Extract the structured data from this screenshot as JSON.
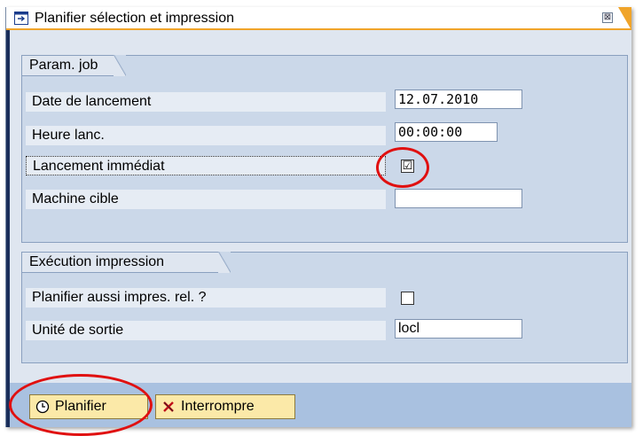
{
  "dialog": {
    "title": "Planifier sélection et impression",
    "close_symbol": "⊠"
  },
  "job_params": {
    "heading": "Param. job",
    "start_date_label": "Date de lancement",
    "start_date_value": "12.07.2010",
    "start_time_label": "Heure lanc.",
    "start_time_value": "00:00:00",
    "immediate_label": "Lancement immédiat",
    "immediate_checked": "☑",
    "target_label": "Machine cible",
    "target_value": ""
  },
  "print_exec": {
    "heading": "Exécution impression",
    "schedule_print_label": "Planifier aussi impres. rel. ?",
    "output_device_label": "Unité de sortie",
    "output_device_value": "locl"
  },
  "toolbar": {
    "schedule_label": "Planifier",
    "cancel_label": "Interrompre"
  },
  "icons": [
    "schedule-dialog-icon",
    "close-icon",
    "clock-icon",
    "cancel-x-icon",
    "checkbox-icon"
  ],
  "colors": {
    "accent": "#f0a42a",
    "annotation": "#e01010",
    "button": "#fbe9a8"
  }
}
